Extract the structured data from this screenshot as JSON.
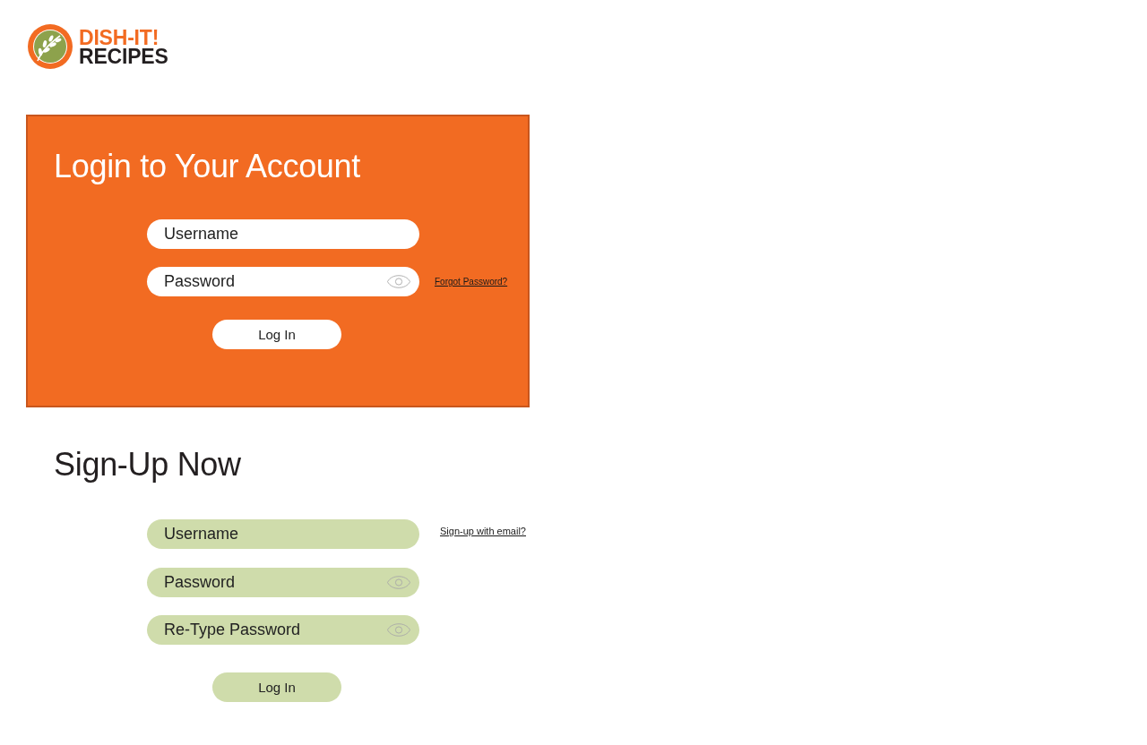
{
  "logo": {
    "line_1": "DISH-IT!",
    "line_2": "RECIPES"
  },
  "login": {
    "title": "Login to Your Account",
    "fields": [
      {
        "kind": "text",
        "placeholder": "Username"
      },
      {
        "kind": "password",
        "placeholder": "Password",
        "link": "Forgot Password?"
      }
    ],
    "button": "Log In"
  },
  "signup": {
    "title": "Sign-Up Now",
    "fields": [
      {
        "kind": "text",
        "placeholder": "Username",
        "link": "Sign-up with email?"
      },
      {
        "kind": "password",
        "placeholder": "Password"
      },
      {
        "kind": "password",
        "placeholder": "Re-Type Password"
      }
    ],
    "button": "Log In"
  }
}
